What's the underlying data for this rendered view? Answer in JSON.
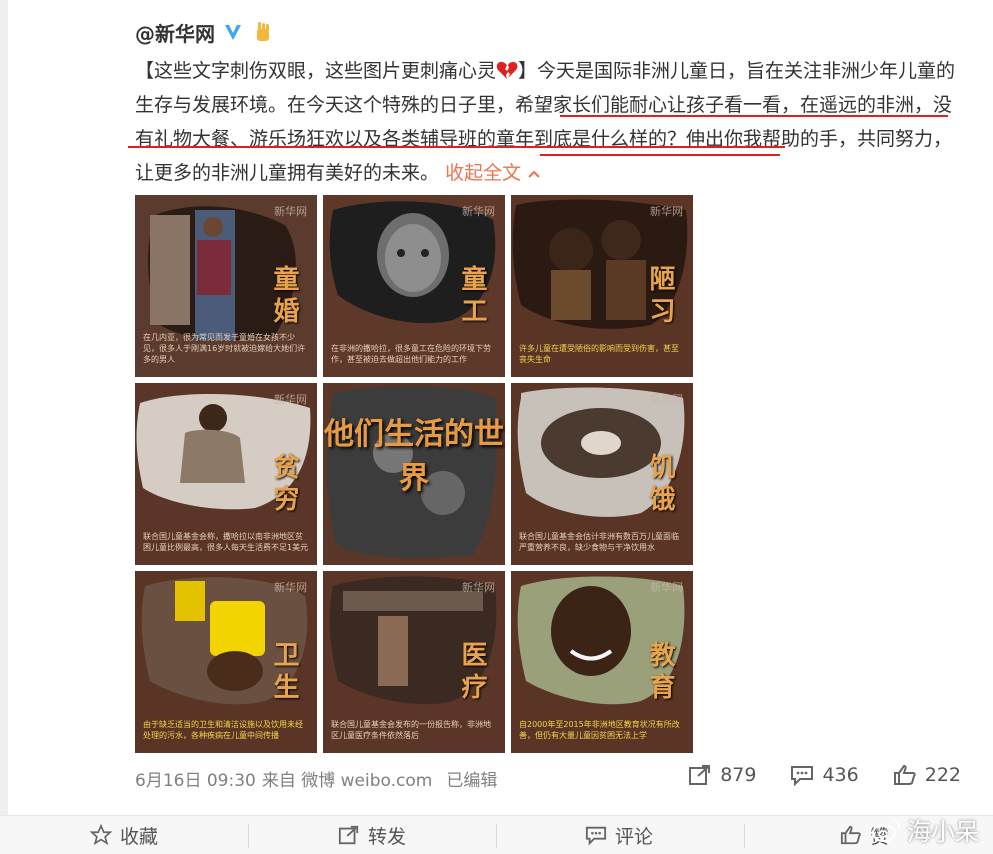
{
  "post": {
    "author": "@新华网",
    "text_part1": "【这些文字刺伤双眼，这些图片更刺痛心灵",
    "text_part2": "】今天是国际非洲儿童日，旨在关注非洲少年儿童的生存与发展环境。在今天这个特殊的日子里，",
    "text_highlight1": "希望家长们能耐心让孩子看一看，在遥远的",
    "text_highlight2": "非洲，没有礼物大餐、游乐场狂欢以及各类辅导班的童年到底是什么样的？",
    "text_part3": "伸出你我帮助的手，共同努力，让更多的非洲儿童拥有美好的未来。",
    "collapse_label": "收起全文"
  },
  "images": [
    {
      "title": "童婚",
      "watermark": "新华网",
      "caption": "在几内亚，很为常见而发于童婚在女孩不少见，很多人于刚满16岁时就被迫嫁给大她们许多的男人"
    },
    {
      "title": "童工",
      "watermark": "新华网",
      "caption": "在非洲的撒哈拉，很多童工在危险的环境下劳作，甚至被迫去做超出他们能力的工作"
    },
    {
      "title": "陋习",
      "watermark": "新华网",
      "caption": "许多儿童在遭受陋俗的影响而受到伤害，甚至丧失生命"
    },
    {
      "title": "贫穷",
      "watermark": "新华网",
      "caption": "联合国儿童基金会称，撒哈拉以南非洲地区贫困儿童比例最高，很多人每天生活费不足1美元"
    },
    {
      "title": "他们生活的世界",
      "watermark": "",
      "caption": ""
    },
    {
      "title": "饥饿",
      "watermark": "新华网",
      "caption": "联合国儿童基金会估计非洲有数百万儿童面临严重营养不良，缺少食物与干净饮用水"
    },
    {
      "title": "卫生",
      "watermark": "新华网",
      "caption": "由于缺乏适当的卫生和清洁设施以及饮用未经处理的污水，各种疾病在儿童中间传播"
    },
    {
      "title": "医疗",
      "watermark": "新华网",
      "caption": "联合国儿童基金会发布的一份报告称，非洲地区儿童医疗条件依然落后"
    },
    {
      "title": "教育",
      "watermark": "新华网",
      "caption": "自2000年至2015年非洲地区教育状况有所改善，但仍有大量儿童因贫困无法上学"
    }
  ],
  "meta": {
    "date": "6月16日 09:30",
    "source": "来自 微博 weibo.com",
    "edited": "已编辑"
  },
  "stats": {
    "reposts": "879",
    "comments": "436",
    "likes": "222"
  },
  "actions": {
    "favorite": "收藏",
    "repost": "转发",
    "comment": "评论",
    "like": "赞"
  },
  "watermark_text": "海小呆",
  "colors": {
    "link": "#eb7350",
    "underline": "#e02020",
    "title_orange": "#e8a34c"
  }
}
